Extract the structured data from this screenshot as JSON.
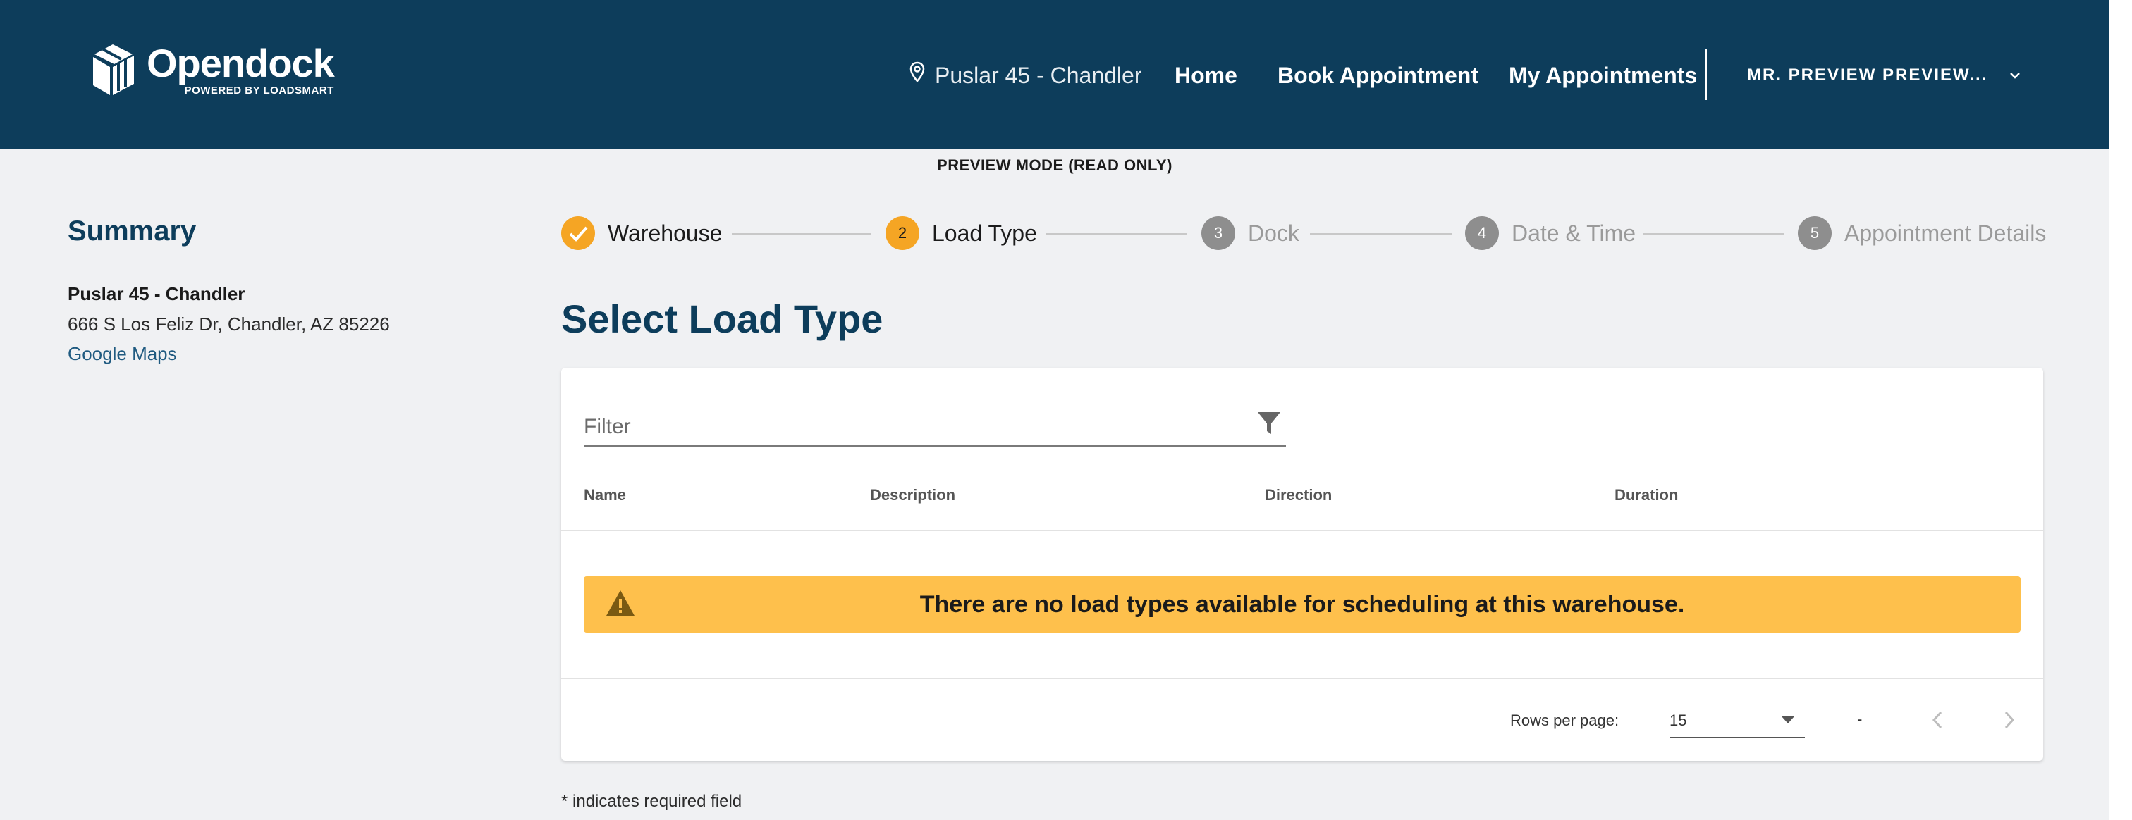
{
  "header": {
    "logo_name": "Opendock",
    "logo_sub": "POWERED BY LOADSMART",
    "location": "Puslar 45 - Chandler",
    "nav": {
      "home": "Home",
      "book": "Book Appointment",
      "mine": "My Appointments"
    },
    "user": "MR. PREVIEW PREVIEW..."
  },
  "preview_mode": "PREVIEW MODE (READ ONLY)",
  "summary": {
    "title": "Summary",
    "warehouse_name": "Puslar 45 - Chandler",
    "address": "666 S Los Feliz Dr, Chandler, AZ 85226",
    "maps_link": "Google Maps"
  },
  "stepper": {
    "steps": [
      {
        "number": "",
        "label": "Warehouse",
        "state": "done"
      },
      {
        "number": "2",
        "label": "Load Type",
        "state": "active"
      },
      {
        "number": "3",
        "label": "Dock",
        "state": "todo"
      },
      {
        "number": "4",
        "label": "Date & Time",
        "state": "todo"
      },
      {
        "number": "5",
        "label": "Appointment Details",
        "state": "todo"
      }
    ]
  },
  "page_title": "Select Load Type",
  "table": {
    "filter_placeholder": "Filter",
    "filter_value": "",
    "columns": [
      "Name",
      "Description",
      "Direction",
      "Duration"
    ],
    "empty_message": "There are no load types available for scheduling at this warehouse.",
    "rows_per_page_label": "Rows per page:",
    "rows_per_page_value": "15",
    "range_text": "-"
  },
  "required_note": "* indicates required field",
  "colors": {
    "header_bg": "#0d3d5b",
    "accent": "#f5a524",
    "alert_bg": "#fec04c",
    "page_bg": "#f0f1f3"
  }
}
